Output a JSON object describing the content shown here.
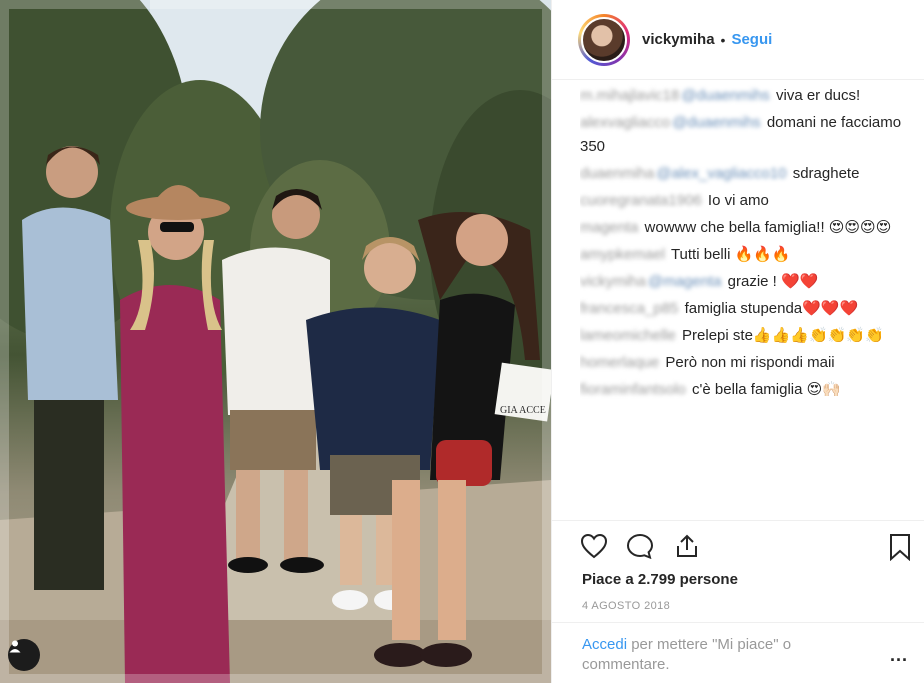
{
  "post": {
    "username": "vickymiha",
    "separator": "•",
    "follow_label": "Segui",
    "likes_text": "Piace a 2.799 persone",
    "date_text": "4 AGOSTO 2018",
    "login_link": "Accedi",
    "login_rest": " per mettere \"Mi piace\" o commentare.",
    "more_label": "..."
  },
  "photo": {
    "sign_text": "GIA ACCE"
  },
  "comments": [
    {
      "user": "m.mihajlavic18",
      "mention": "@duaenmihs",
      "text": " viva er ducs!"
    },
    {
      "user": "alexvagliacco",
      "mention": "@duaenmihs",
      "text": " domani ne facciamo 350"
    },
    {
      "user": "duaenmiha",
      "mention": "@alex_vagliacco10",
      "text": " sdraghete"
    },
    {
      "user": "cuoregranata1906",
      "mention": "",
      "text": " Io vi amo"
    },
    {
      "user": "magenta",
      "mention": "",
      "text": " wowww che bella famiglia!! 😍😍😍😍"
    },
    {
      "user": "amypkemael",
      "mention": "",
      "text": " Tutti belli 🔥🔥🔥"
    },
    {
      "user": "vickymiha",
      "mention": "@magenta",
      "text": " grazie ! ❤️❤️"
    },
    {
      "user": "francesca_p85",
      "mention": "",
      "text": " famiglia stupenda❤️❤️❤️"
    },
    {
      "user": "lameomichelle",
      "mention": "",
      "text": " Prelepi ste👍👍👍👏👏👏👏"
    },
    {
      "user": "homerlaque",
      "mention": "",
      "text": " Però non mi rispondi maii"
    },
    {
      "user": "fioraminfantsolo",
      "mention": "",
      "text": " c'è bella famiglia 😍🙌🏻"
    }
  ],
  "icons": {
    "like": "heart-outline-icon",
    "comment": "comment-bubble-icon",
    "share": "share-upload-icon",
    "save": "bookmark-icon",
    "tag": "user-tag-icon"
  },
  "colors": {
    "link": "#3897f0",
    "text": "#262626",
    "muted": "#999999"
  }
}
